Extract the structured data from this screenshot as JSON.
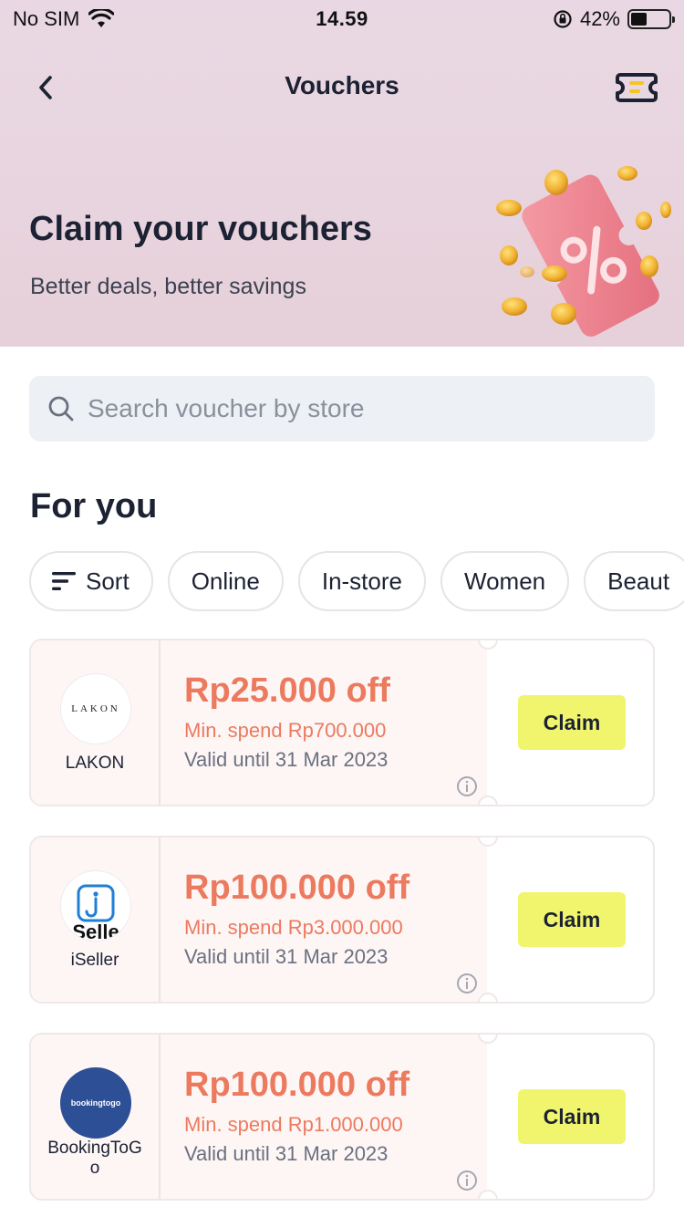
{
  "status_bar": {
    "carrier": "No SIM",
    "time": "14.59",
    "battery": "42%",
    "battery_level": 0.42
  },
  "header": {
    "title": "Vouchers"
  },
  "hero": {
    "title": "Claim your vouchers",
    "subtitle": "Better deals, better savings"
  },
  "search": {
    "placeholder": "Search voucher by store",
    "value": ""
  },
  "section": {
    "title": "For you"
  },
  "filters": [
    {
      "label": "Sort",
      "icon": "sort-icon"
    },
    {
      "label": "Online"
    },
    {
      "label": "In-store"
    },
    {
      "label": "Women"
    },
    {
      "label": "Beaut"
    }
  ],
  "vouchers": [
    {
      "store": "LAKON",
      "logo_text": "LAKON",
      "amount": "Rp25.000 off",
      "min_spend": "Min. spend Rp700.000",
      "valid": "Valid until 31 Mar 2023",
      "claim_label": "Claim"
    },
    {
      "store": "iSeller",
      "logo_text": "Selle",
      "amount": "Rp100.000 off",
      "min_spend": "Min. spend Rp3.000.000",
      "valid": "Valid until 31 Mar 2023",
      "claim_label": "Claim"
    },
    {
      "store": "BookingToG\no",
      "logo_text": "bookingtogo",
      "amount": "Rp100.000 off",
      "min_spend": "Min. spend Rp1.000.000",
      "valid": "Valid until 31 Mar 2023",
      "claim_label": "Claim"
    }
  ],
  "colors": {
    "accent_orange": "#ec7a5f",
    "claim_yellow": "#f1f56e",
    "hero_bg": "#e9d8e3",
    "text_dark": "#1c2233"
  }
}
